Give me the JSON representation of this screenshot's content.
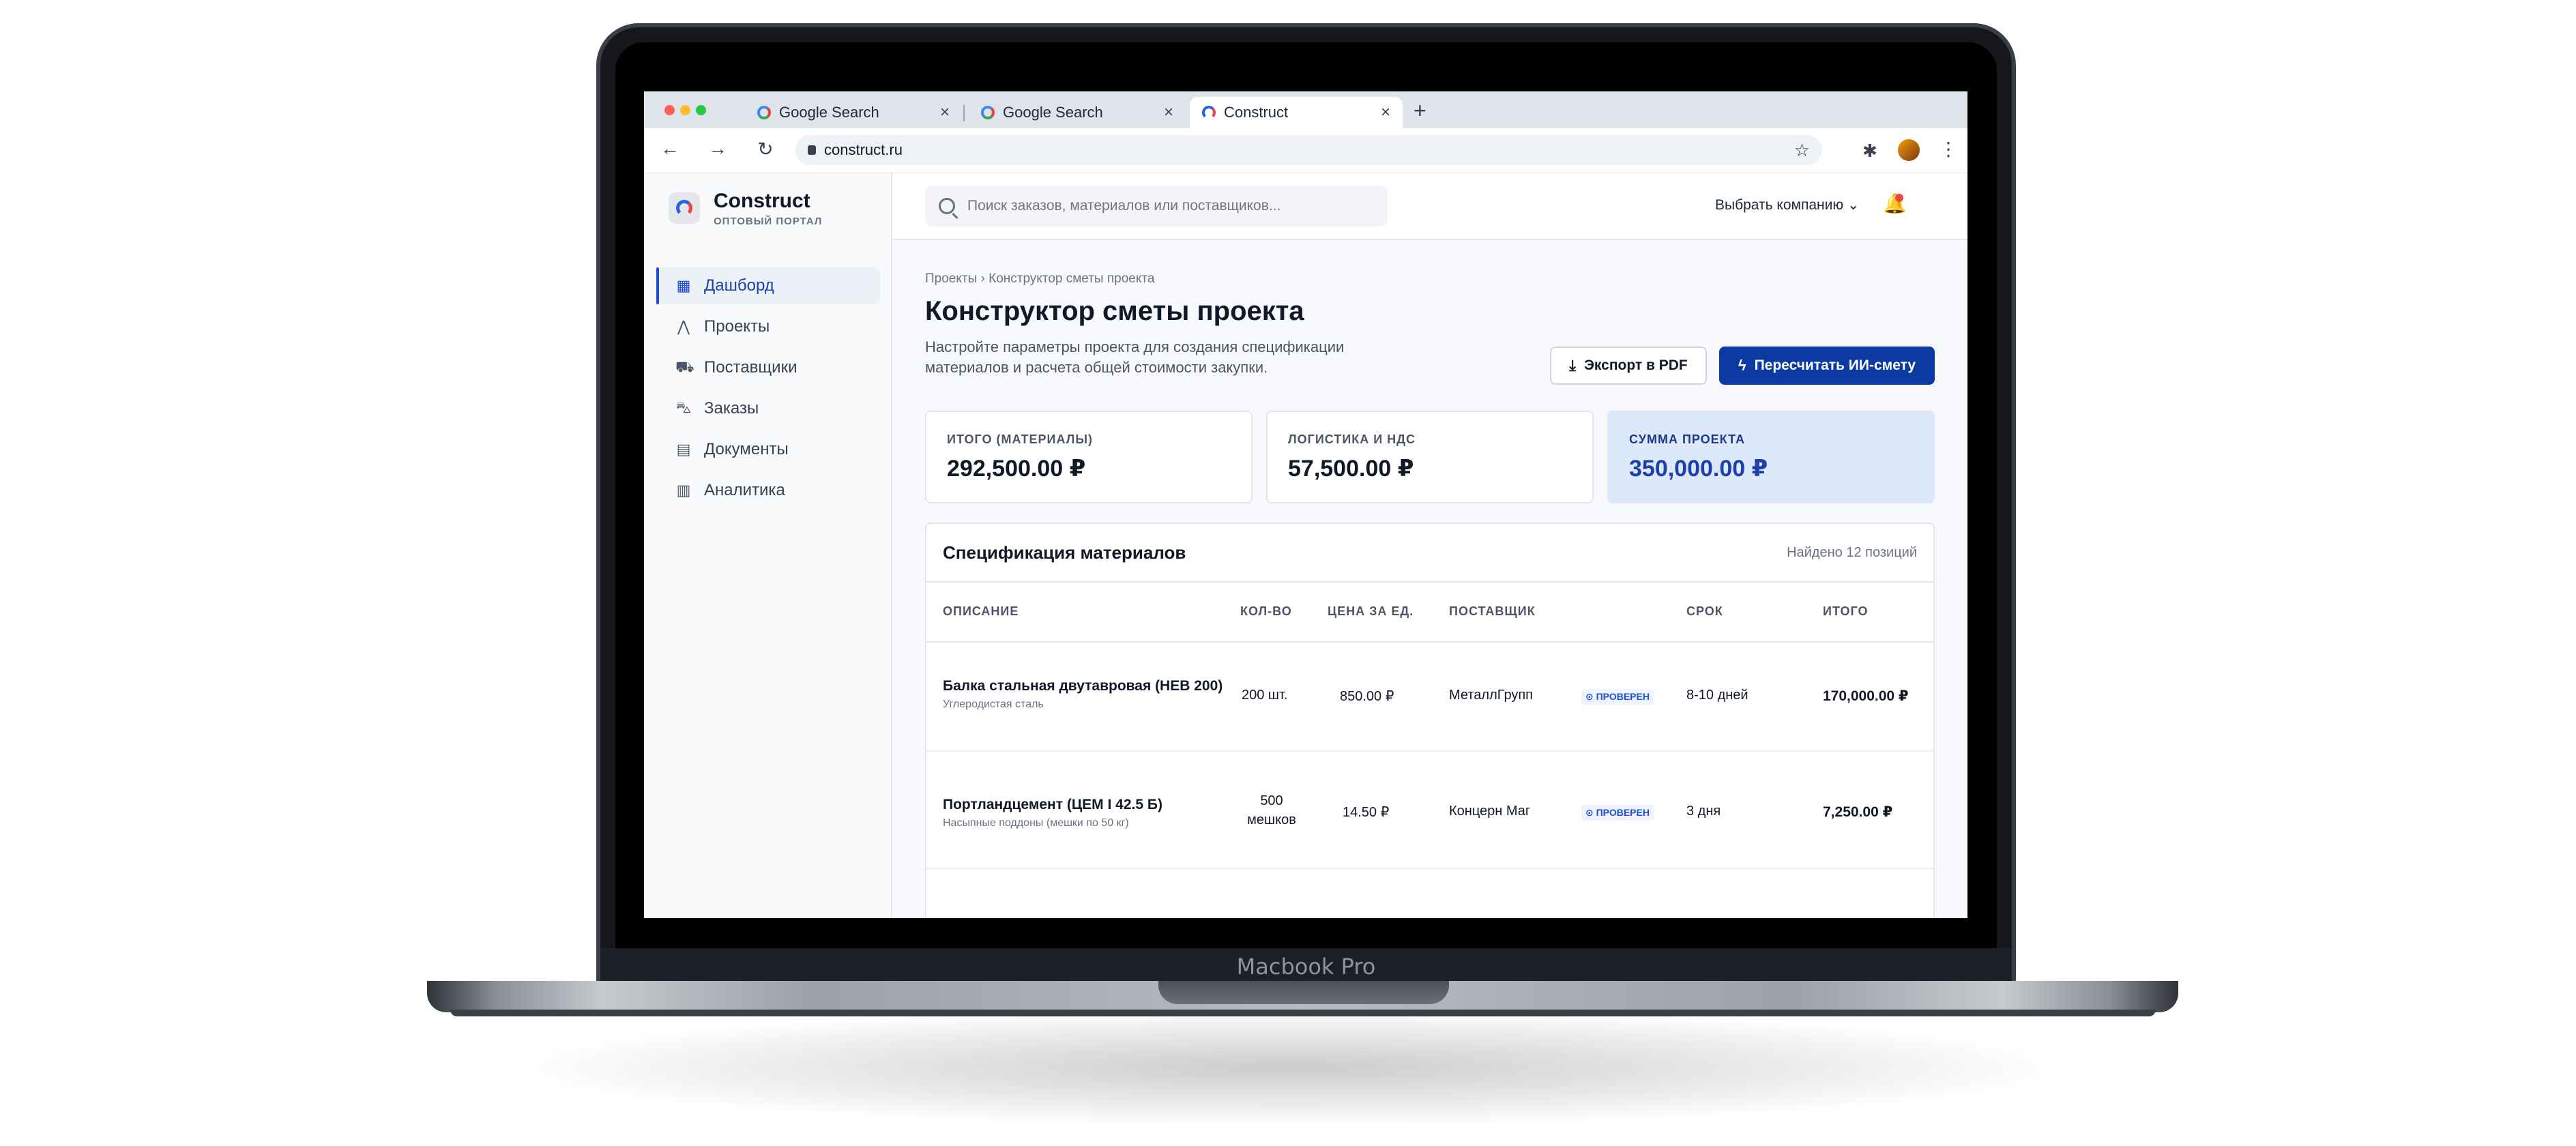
{
  "device": {
    "label": "Macbook Pro"
  },
  "browser": {
    "tabs": [
      {
        "title": "Google Search",
        "close": "×"
      },
      {
        "title": "Google Search",
        "close": "×"
      },
      {
        "title": "Construct",
        "close": "×"
      }
    ],
    "new_tab": "+",
    "url": "construct.ru",
    "back": "←",
    "forward": "→",
    "reload": "↻",
    "star": "☆",
    "extensions": "✱",
    "menu": "⋮"
  },
  "app": {
    "name": "Construct",
    "subtitle": "ОПТОВЫЙ ПОРТАЛ",
    "nav": [
      {
        "label": "Дашборд",
        "icon": "▦",
        "active": true
      },
      {
        "label": "Проекты",
        "icon": "⋀"
      },
      {
        "label": "Поставщики",
        "icon": "⛟"
      },
      {
        "label": "Заказы",
        "icon": "⛍"
      },
      {
        "label": "Документы",
        "icon": "▤"
      },
      {
        "label": "Аналитика",
        "icon": "▥"
      }
    ],
    "search_placeholder": "Поиск заказов, материалов или поставщиков...",
    "company_select": "Выбрать компанию ⌄",
    "bell": "🔔"
  },
  "page": {
    "breadcrumb": "Проекты  ›  Конструктор сметы проекта",
    "title": "Конструктор сметы проекта",
    "description": "Настройте параметры проекта для создания спецификации материалов и расчета общей стоимости закупки.",
    "export_button": "Экспорт в PDF",
    "recalc_button": "Пересчитать ИИ-смету",
    "export_icon": "⤓",
    "recalc_icon": "ϟ"
  },
  "stats": [
    {
      "label": "ИТОГО (МАТЕРИАЛЫ)",
      "value": "292,500.00 ₽"
    },
    {
      "label": "ЛОГИСТИКА И НДС",
      "value": "57,500.00 ₽"
    },
    {
      "label": "СУММА ПРОЕКТА",
      "value": "350,000.00 ₽"
    }
  ],
  "table": {
    "title": "Спецификация материалов",
    "count": "Найдено 12 позиций",
    "headers": [
      "ОПИСАНИЕ",
      "КОЛ-ВО",
      "ЦЕНА ЗА ЕД.",
      "ПОСТАВЩИК",
      "СРОК",
      "ИТОГО"
    ],
    "rows": [
      {
        "name": "Балка стальная двутавровая (HEB 200)",
        "sub": "Углеродистая сталь",
        "qty": "200 шт.",
        "price": "850.00 ₽",
        "supplier": "МеталлГрупп",
        "badge": "⊙ ПРОВЕРЕН",
        "term": "8-10 дней",
        "total": "170,000.00 ₽"
      },
      {
        "name": "Портландцемент (ЦЕМ I 42.5 Б)",
        "sub": "Насыпные поддоны (мешки по 50 кг)",
        "qty": "500 мешков",
        "price": "14.50 ₽",
        "supplier": "Концерн Маг",
        "badge": "⊙ ПРОВЕРЕН",
        "term": "3 дня",
        "total": "7,250.00 ₽"
      }
    ]
  }
}
